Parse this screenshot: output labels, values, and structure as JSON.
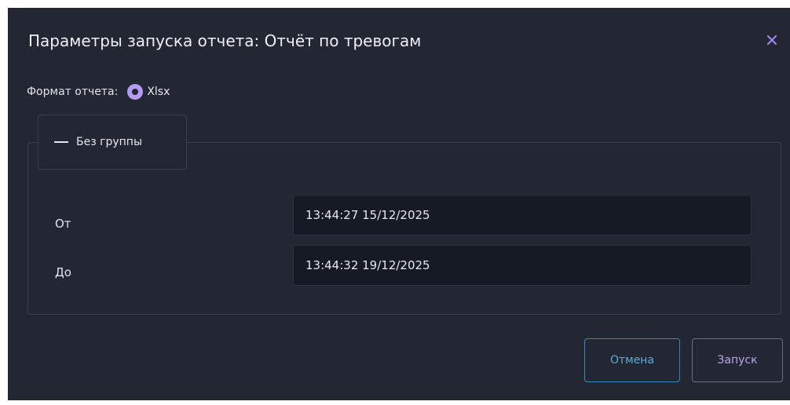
{
  "dialog": {
    "title": "Параметры запуска отчета: Отчёт по тревогам",
    "close_icon": "close-icon"
  },
  "format": {
    "label": "Формат отчета:",
    "option_label": "Xlsx",
    "selected": true,
    "accent_color": "#b59cf0"
  },
  "group": {
    "toggle_icon": "minus-icon",
    "label": "Без группы"
  },
  "fields": {
    "from_label": "От",
    "from_value": "13:44:27 15/12/2025",
    "to_label": "До",
    "to_value": "13:44:32 19/12/2025"
  },
  "buttons": {
    "cancel_label": "Отмена",
    "run_label": "Запуск"
  }
}
